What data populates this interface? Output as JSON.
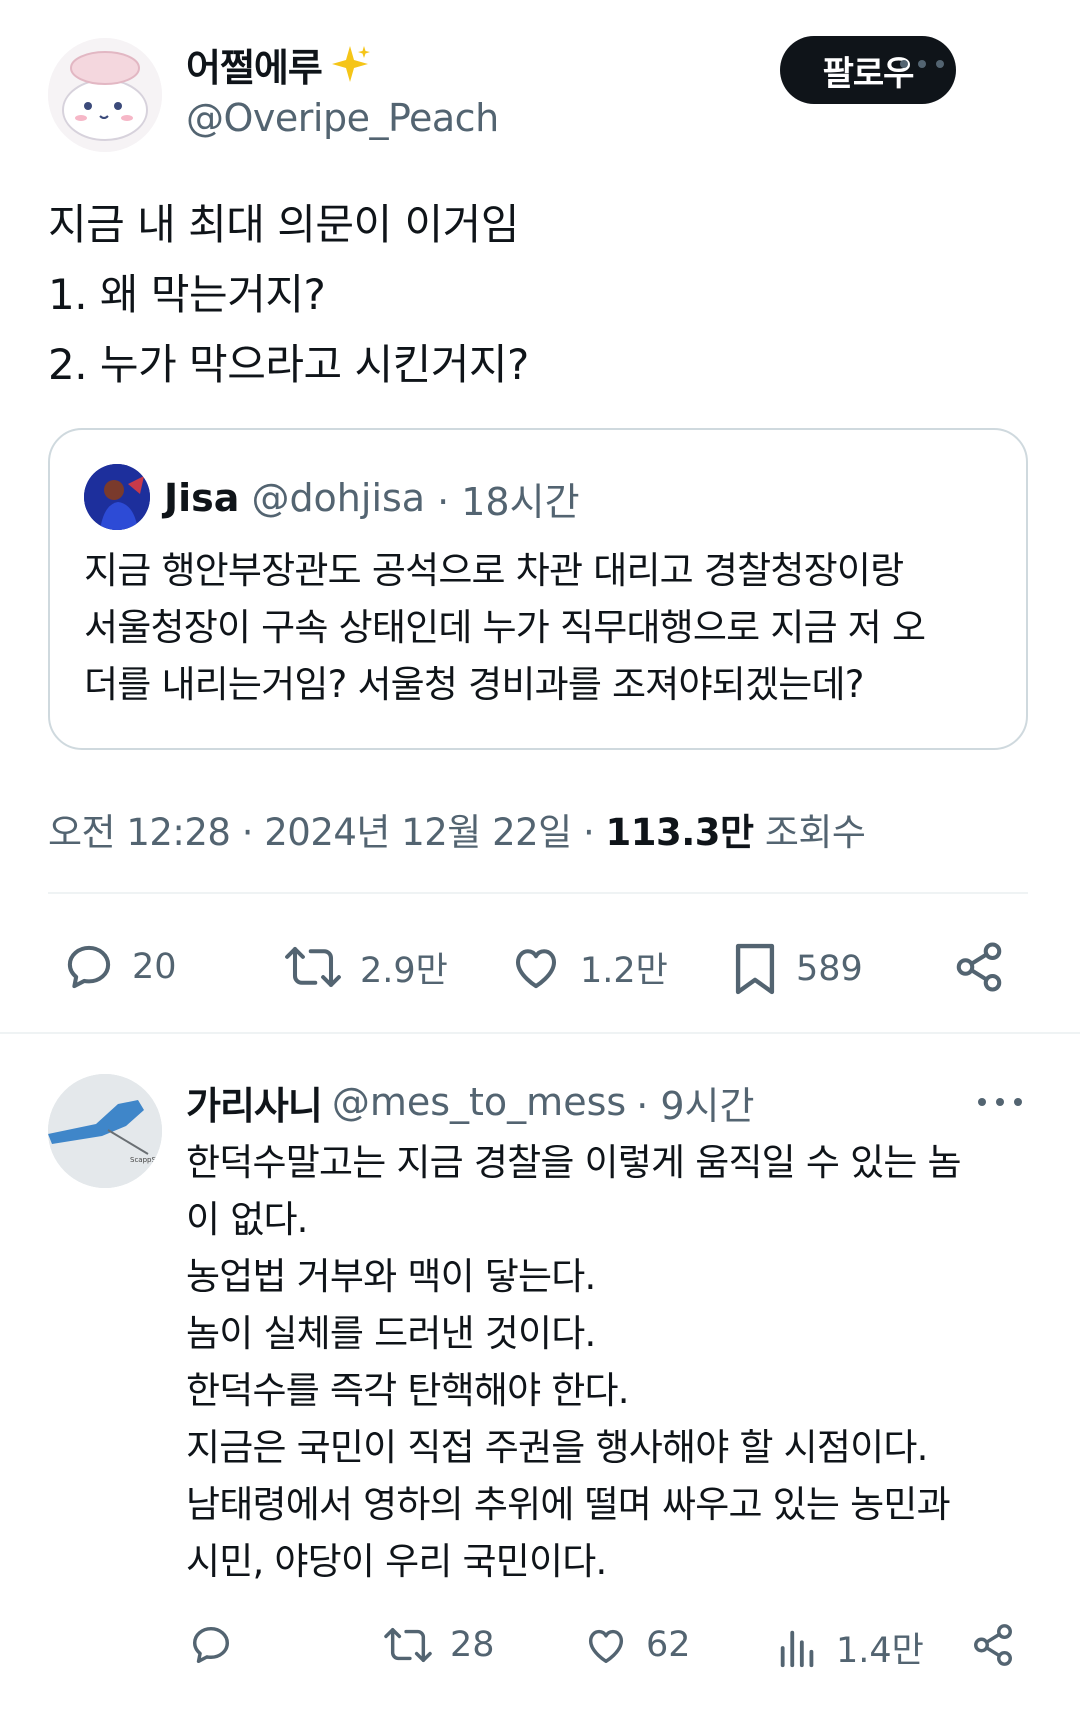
{
  "tweet": {
    "author_name": "어쩔에루",
    "author_handle": "@Overipe_Peach",
    "follow_label": "팔로우",
    "text_lines": [
      "지금 내 최대 의문이 이거임",
      "1. 왜 막는거지?",
      "2. 누가 막으라고 시킨거지?"
    ],
    "quote": {
      "name": "Jisa",
      "handle": "@dohjisa",
      "time": "· 18시간",
      "lines": [
        "지금 행안부장관도 공석으로 차관 대리고 경찰청장이랑",
        "서울청장이 구속 상태인데 누가 직무대행으로 지금 저 오",
        "더를 내리는거임? 서울청 경비과를 조져야되겠는데?"
      ]
    },
    "timestamp": "오전 12:28 · 2024년 12월 22일 · ",
    "views_count": "113.3만",
    "views_label": " 조회수",
    "stats": {
      "replies": "20",
      "retweets": "2.9만",
      "likes": "1.2만",
      "bookmarks": "589"
    }
  },
  "reply": {
    "name": "가리사니",
    "handle": "@mes_to_mess",
    "time": "· 9시간",
    "lines": [
      "한덕수말고는 지금 경찰을 이렇게 움직일 수 있는 놈",
      "이 없다.",
      "농업법 거부와 맥이 닿는다.",
      "놈이 실체를 드러낸 것이다.",
      "한덕수를 즉각 탄핵해야 한다.",
      "지금은 국민이 직접 주권을 행사해야 할 시점이다.",
      "남태령에서 영하의 추위에 떨며 싸우고 있는 농민과",
      "시민, 야당이 우리 국민이다."
    ],
    "stats": {
      "retweets": "28",
      "likes": "62",
      "views": "1.4만"
    }
  },
  "colors": {
    "text": "#0f1419",
    "muted": "#536471",
    "border": "#cfd9de",
    "divider": "#eff3f4",
    "sparkle": "#f5c518"
  },
  "icons": [
    "more-icon",
    "reply-icon",
    "retweet-icon",
    "like-icon",
    "bookmark-icon",
    "share-icon",
    "views-icon",
    "sparkle-emoji"
  ]
}
